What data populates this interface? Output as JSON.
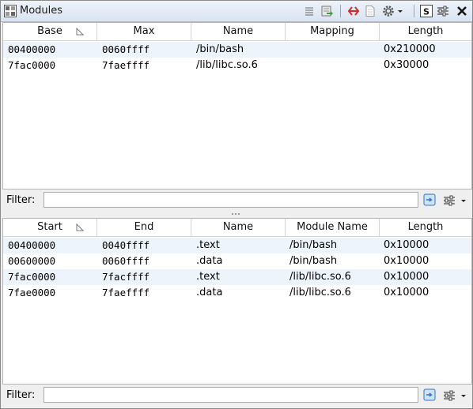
{
  "window": {
    "title": "Modules"
  },
  "modules_table": {
    "columns": [
      "Base",
      "Max",
      "Name",
      "Mapping",
      "Length"
    ],
    "rows": [
      [
        "00400000",
        "0060ffff",
        "/bin/bash",
        "",
        "0x210000"
      ],
      [
        "7fac0000",
        "7faeffff",
        "/lib/libc.so.6",
        "",
        "0x30000"
      ]
    ]
  },
  "modules_filter": {
    "label": "Filter:",
    "value": ""
  },
  "sections_table": {
    "columns": [
      "Start",
      "End",
      "Name",
      "Module Name",
      "Length"
    ],
    "rows": [
      [
        "00400000",
        "0040ffff",
        ".text",
        "/bin/bash",
        "0x10000"
      ],
      [
        "00600000",
        "0060ffff",
        ".data",
        "/bin/bash",
        "0x10000"
      ],
      [
        "7fac0000",
        "7facffff",
        ".text",
        "/lib/libc.so.6",
        "0x10000"
      ],
      [
        "7fae0000",
        "7faeffff",
        ".data",
        "/lib/libc.so.6",
        "0x10000"
      ]
    ]
  },
  "sections_filter": {
    "label": "Filter:",
    "value": ""
  },
  "icons": {
    "title": "modules-window-icon",
    "toolbar": [
      "lines-icon",
      "refresh-export-icon",
      "red-arrows-icon",
      "page-icon",
      "gear-icon",
      "dropdown-icon",
      "s-toggle-icon",
      "sliders-icon",
      "close-icon"
    ],
    "filter": [
      "filter-apply-icon",
      "sliders-icon",
      "dropdown-icon"
    ]
  },
  "colors": {
    "row_alt": "#eef4fb",
    "titlebar": "#d9e3f1",
    "accent": "#2f74c8",
    "red_icon": "#d22a2a"
  }
}
